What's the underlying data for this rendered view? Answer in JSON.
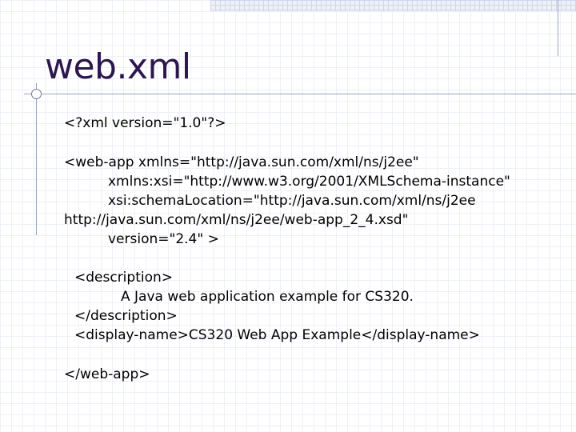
{
  "slide": {
    "title": "web.xml",
    "lines": [
      "<?xml version=\"1.0\"?>",
      "<web-app xmlns=\"http://java.sun.com/xml/ns/j2ee\"",
      "xmlns:xsi=\"http://www.w3.org/2001/XMLSchema-instance\"",
      "xsi:schemaLocation=\"http://java.sun.com/xml/ns/j2ee",
      "http://java.sun.com/xml/ns/j2ee/web-app_2_4.xsd\"",
      "version=\"2.4\" >",
      "<description>",
      "A Java web application example for CS320.",
      "</description>",
      "<display-name>CS320 Web App Example</display-name>",
      "</web-app>"
    ]
  }
}
